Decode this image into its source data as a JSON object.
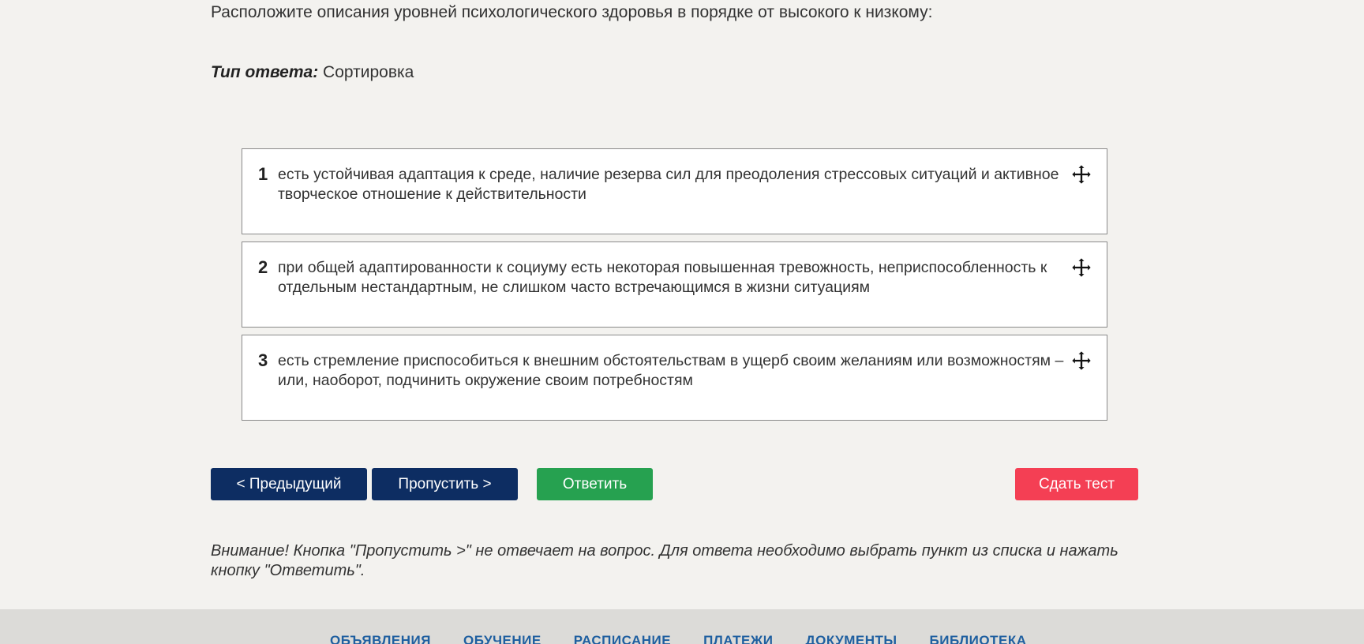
{
  "question": {
    "text": "Расположите описания уровней психологического здоровья в порядке от высокого к низкому:",
    "answer_type_label": "Тип ответа:",
    "answer_type_value": "Сортировка"
  },
  "sort_items": [
    {
      "num": "1",
      "text": "есть устойчивая адаптация к среде, наличие резерва сил для преодоления стрессовых ситуаций и активное творческое отношение к действительности",
      "icon": "move-icon"
    },
    {
      "num": "2",
      "text": "при общей адаптированности к социуму есть некоторая повышенная тревожность, неприспособленность к отдельным нестандартным, не слишком часто встречающимся в жизни ситуациям",
      "icon": "move-icon"
    },
    {
      "num": "3",
      "text": "есть стремление приспособиться к внешним обстоятельствам в ущерб своим желаниям или возможностям – или, наоборот, подчинить окружение своим потребностям",
      "icon": "move-icon"
    }
  ],
  "buttons": {
    "prev": "< Предыдущий",
    "skip": "Пропустить >",
    "answer": "Ответить",
    "submit": "Сдать тест"
  },
  "note": "Внимание! Кнопка \"Пропустить >\" не отвечает на вопрос. Для ответа необходимо выбрать пункт из списка и нажать кнопку \"Ответить\".",
  "footer_nav": [
    "ОБЪЯВЛЕНИЯ",
    "ОБУЧЕНИЕ",
    "РАСПИСАНИЕ",
    "ПЛАТЕЖИ",
    "ДОКУМЕНТЫ",
    "БИБЛИОТЕКА"
  ],
  "colors": {
    "nav_button": "#0d2d62",
    "answer_button": "#26a150",
    "submit_button": "#f43f54",
    "footer_link": "#1f5fa0"
  }
}
